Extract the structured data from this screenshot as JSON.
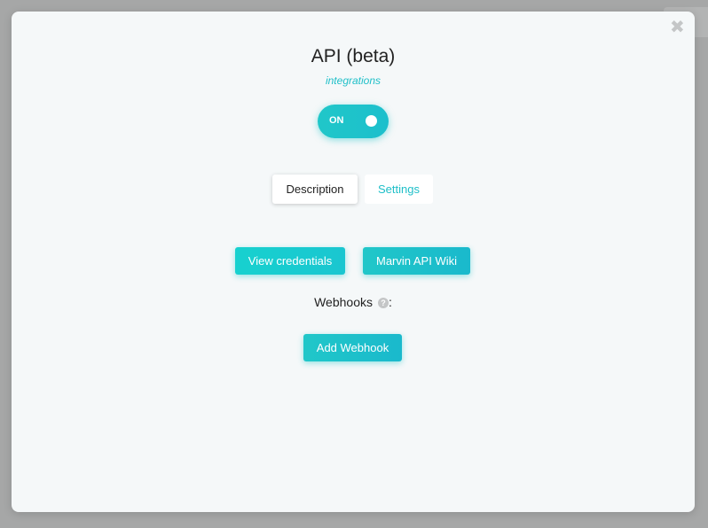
{
  "modal": {
    "close_glyph": "✖",
    "title": "API (beta)",
    "subtitle": "integrations",
    "toggle": {
      "label": "ON",
      "state": "on"
    },
    "tabs": [
      {
        "label": "Description",
        "active": true
      },
      {
        "label": "Settings",
        "active": false
      }
    ],
    "buttons": {
      "view_credentials": "View credentials",
      "api_wiki": "Marvin API Wiki",
      "add_webhook": "Add Webhook"
    },
    "webhooks": {
      "label": "Webhooks",
      "help_glyph": "?",
      "suffix": ":"
    }
  },
  "colors": {
    "accent": "#1fbfc8",
    "modal_bg": "#f5f8f9",
    "overlay": "#a6a7a7"
  },
  "icons": {
    "close": "close-icon",
    "help": "question-circle-icon"
  }
}
